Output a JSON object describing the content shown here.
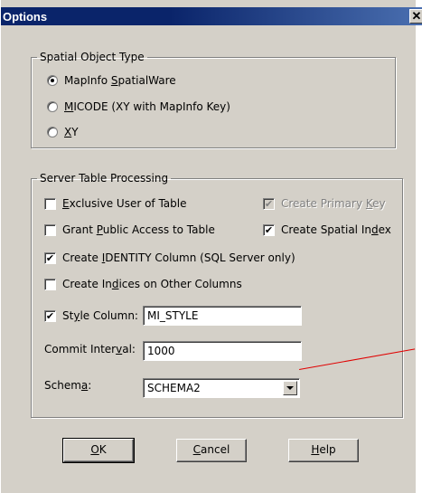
{
  "window": {
    "title": "Options",
    "close_glyph": "✕"
  },
  "spatial_object_type": {
    "legend": "Spatial Object Type",
    "options": [
      {
        "label_pre": "MapInfo ",
        "label_u": "S",
        "label_post": "patialWare",
        "selected": true
      },
      {
        "label_pre": "",
        "label_u": "M",
        "label_post": "ICODE (XY with MapInfo Key)",
        "selected": false
      },
      {
        "label_pre": "",
        "label_u": "X",
        "label_post": "Y",
        "selected": false
      }
    ]
  },
  "server_table_processing": {
    "legend": "Server Table Processing",
    "exclusive_user": {
      "label_pre": "",
      "label_u": "E",
      "label_post": "xclusive User of Table",
      "checked": false
    },
    "create_primary_key": {
      "label_pre": "Create Primary ",
      "label_u": "K",
      "label_post": "ey",
      "checked": true,
      "disabled": true
    },
    "grant_public": {
      "label_pre": "Grant ",
      "label_u": "P",
      "label_post": "ublic Access to Table",
      "checked": false
    },
    "create_spatial_index": {
      "label_pre": "Create Spatial In",
      "label_u": "d",
      "label_post": "ex",
      "checked": true
    },
    "create_identity": {
      "label_pre": "Create ",
      "label_u": "I",
      "label_post": "DENTITY Column (SQL Server only)",
      "checked": true
    },
    "create_indices": {
      "label_pre": "Create In",
      "label_u": "d",
      "label_post": "ices on Other Columns",
      "checked": false
    },
    "style_column": {
      "label_pre": "St",
      "label_u": "y",
      "label_post": "le Column:",
      "checked": true,
      "value": "MI_STYLE"
    },
    "commit_interval": {
      "label_pre": "Commit Inter",
      "label_u": "v",
      "label_post": "al:",
      "value": "1000"
    },
    "schema": {
      "label_pre": "Schem",
      "label_u": "a",
      "label_post": ":",
      "value": "SCHEMA2"
    }
  },
  "buttons": {
    "ok": {
      "label_u": "O",
      "label_post": "K"
    },
    "cancel": {
      "label_u": "C",
      "label_post": "ancel"
    },
    "help": {
      "label_u": "H",
      "label_post": "elp"
    }
  },
  "check_glyph": "✔",
  "colors": {
    "title_bar": "#0a246a",
    "dialog_face": "#d4d0c8",
    "annotation": "#e00000"
  }
}
